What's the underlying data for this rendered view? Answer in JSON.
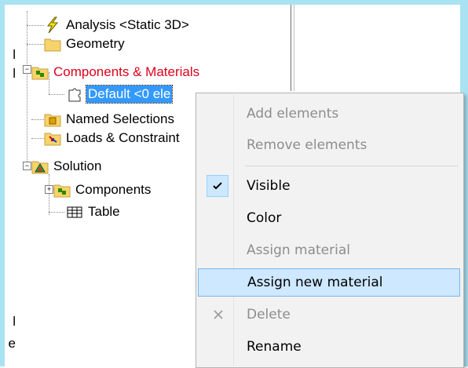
{
  "tree": {
    "analysis": "Analysis <Static 3D>",
    "geometry": "Geometry",
    "components_materials": "Components & Materials",
    "default": "Default <0 ele",
    "named_selections": "Named Selections",
    "loads_constraints": "Loads & Constraint",
    "solution": "Solution",
    "components": "Components",
    "table": "Table"
  },
  "menu": {
    "items": [
      {
        "label": "Add elements",
        "enabled": false
      },
      {
        "label": "Remove elements",
        "enabled": false
      },
      {
        "label": "Visible",
        "enabled": true,
        "checked": true
      },
      {
        "label": "Color",
        "enabled": true
      },
      {
        "label": "Assign material",
        "enabled": false
      },
      {
        "label": "Assign new material",
        "enabled": true,
        "hover": true
      },
      {
        "label": "Delete",
        "enabled": false
      },
      {
        "label": "Rename",
        "enabled": true
      }
    ]
  },
  "cut_text": {
    "left_a": "l",
    "left_b": "l",
    "left_c": "l",
    "left_d": "e"
  },
  "icons": {
    "analysis": "lightning-icon",
    "geometry": "folder-icon",
    "components_materials": "components-folder-icon",
    "default": "puzzle-icon",
    "named_selections": "named-selections-icon",
    "loads_constraints": "loads-icon",
    "solution": "solution-triangle-icon",
    "components": "components-folder-icon",
    "table": "table-grid-icon",
    "visible_check": "checkmark-icon",
    "delete_x": "x-icon"
  },
  "colors": {
    "frame": "#a9e2f3",
    "selection": "#3399ff",
    "red_label": "#e0001b",
    "menu_hover": "#cde8ff"
  }
}
